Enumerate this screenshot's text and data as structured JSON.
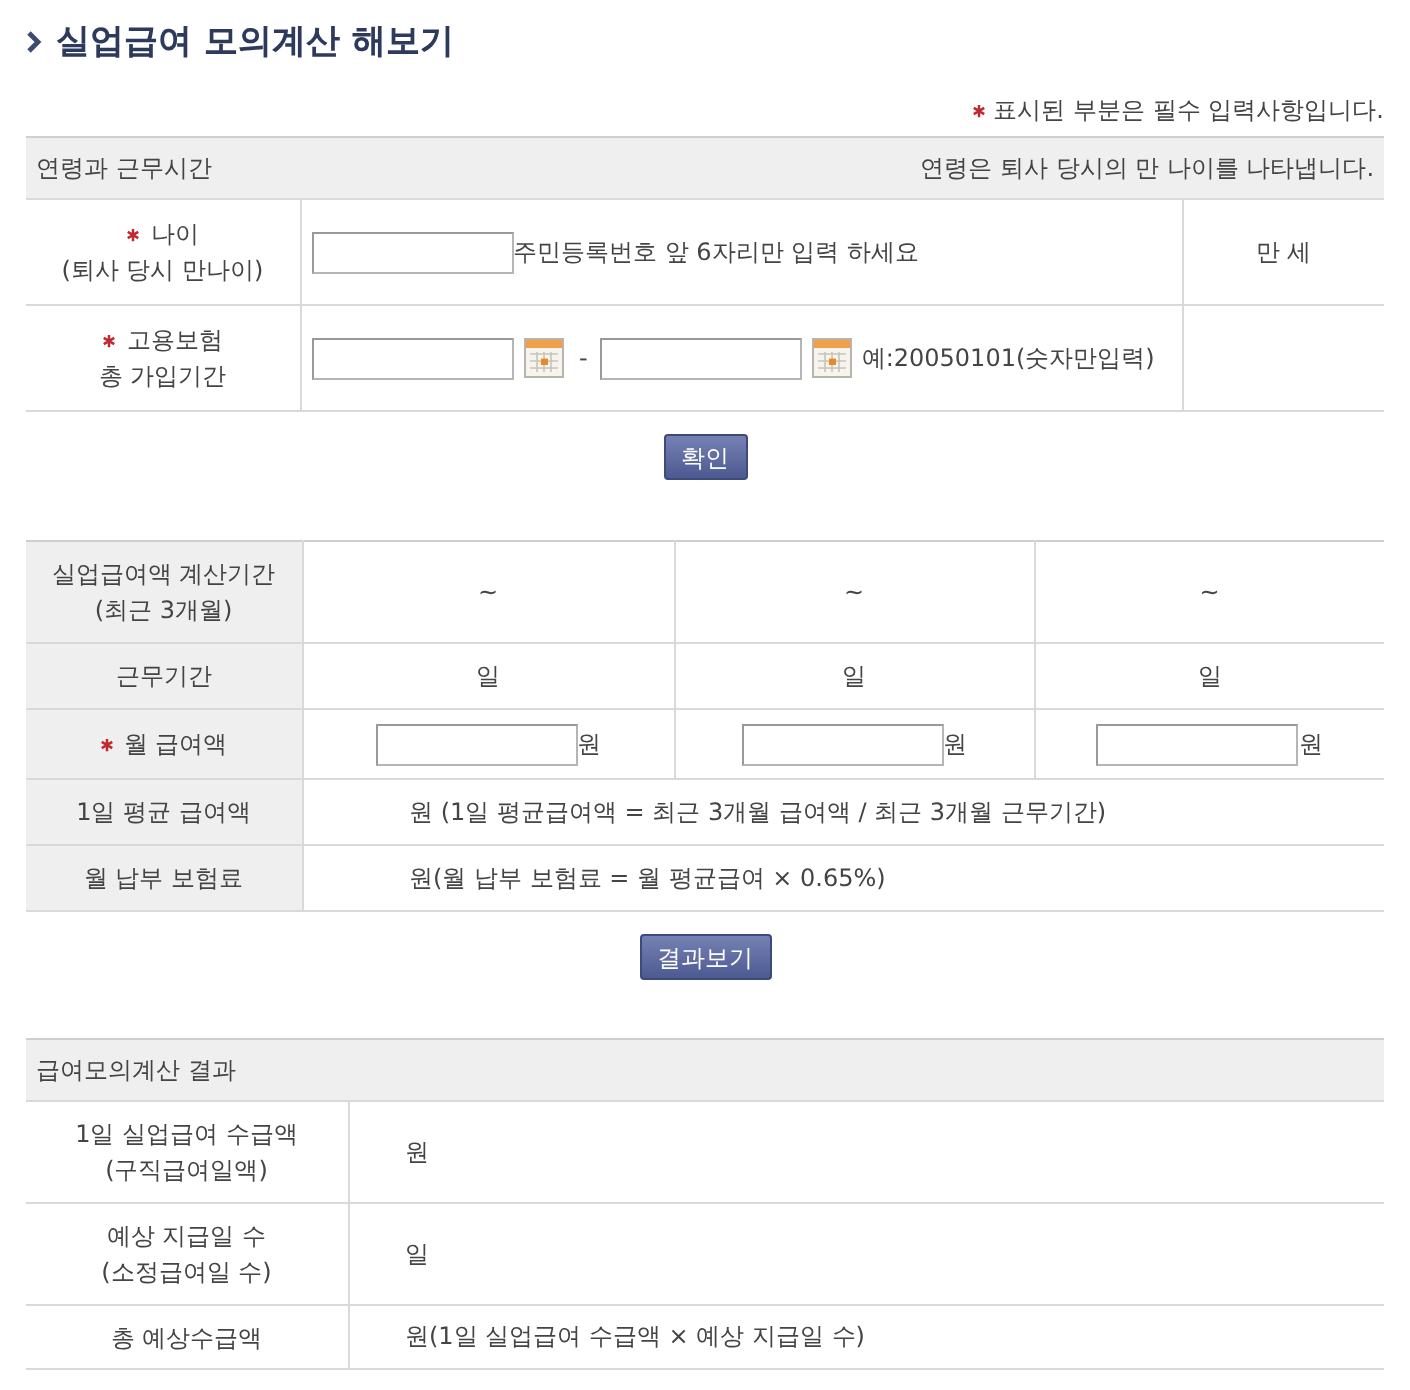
{
  "title": "실업급여 모의계산 해보기",
  "required_note": {
    "required": true,
    "text": "표시된 부분은 필수 입력사항입니다."
  },
  "age_section": {
    "title": "연령과 근무시간",
    "note": "연령은 퇴사 당시의 만 나이를 나타냅니다.",
    "rows": [
      {
        "kind": "age",
        "required": true,
        "label": "나이",
        "sublabel": "(퇴사 당시 만나이)",
        "hint": "주민등록번호 앞 6자리만 입력 하세요",
        "unit": "만 세"
      },
      {
        "kind": "period",
        "required": true,
        "label": "고용보험",
        "sublabel": "총 가입기간",
        "separator": "-",
        "hint": "예:20050101(숫자만입력)"
      }
    ]
  },
  "confirm_button": "확인",
  "salary_table": {
    "rows": [
      {
        "kind": "range",
        "required": false,
        "label": "실업급여액 계산기간",
        "sublabel": "(최근 3개월)",
        "cells": [
          "~",
          "~",
          "~"
        ]
      },
      {
        "kind": "days",
        "required": false,
        "label": "근무기간",
        "cells": [
          "일",
          "일",
          "일"
        ]
      },
      {
        "kind": "input",
        "required": true,
        "label": "월 급여액",
        "cells": [
          "원",
          "원",
          "원"
        ]
      },
      {
        "kind": "formula",
        "required": false,
        "label": "1일 평균 급여액",
        "text": "원 (1일 평균급여액 = 최근 3개월 급여액 / 최근 3개월 근무기간)"
      },
      {
        "kind": "formula",
        "required": false,
        "label": "월 납부 보험료",
        "text": "원(월 납부 보험료 = 월 평균급여 × 0.65%)"
      }
    ]
  },
  "result_button": "결과보기",
  "result_section": {
    "title": "급여모의계산 결과",
    "rows": [
      {
        "label": "1일 실업급여 수급액",
        "sublabel": "(구직급여일액)",
        "value": "원"
      },
      {
        "label": "예상 지급일 수",
        "sublabel": "(소정급여일 수)",
        "value": "일"
      },
      {
        "label": "총 예상수급액",
        "value": "원(1일 실업급여 수급액 × 예상 지급일 수)"
      }
    ]
  }
}
